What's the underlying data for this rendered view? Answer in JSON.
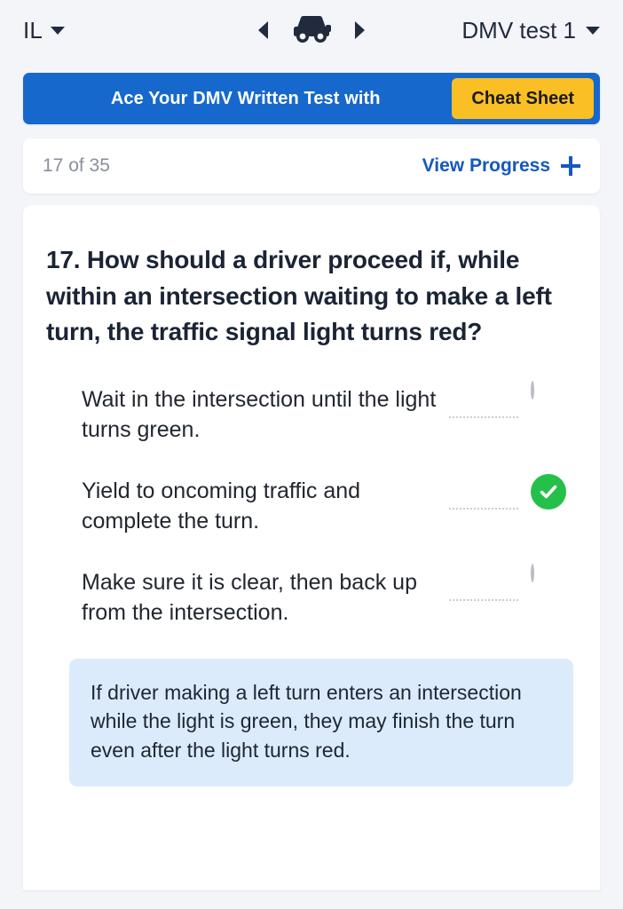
{
  "topbar": {
    "state": "IL",
    "state_caret_icon": "chevron-down-icon",
    "prev_icon": "triangle-left-icon",
    "vehicle_icon": "car-icon",
    "next_icon": "triangle-right-icon",
    "test_name": "DMV test 1",
    "test_caret_icon": "chevron-down-icon"
  },
  "promo": {
    "text": "Ace Your DMV Written Test with",
    "button_label": "Cheat Sheet",
    "bg_color": "#1668cc",
    "button_color": "#f9bf24"
  },
  "progress": {
    "count_label": "17 of 35",
    "current": 17,
    "total": 35,
    "view_progress_label": "View Progress",
    "plus_icon": "plus-icon",
    "accent_color": "#1558c0"
  },
  "question": {
    "number": "17.",
    "text": "17. How should a driver proceed if, while within an intersection waiting to make a left turn, the traffic signal light turns red?",
    "options": [
      {
        "label": "Wait in the intersection until the light turns green.",
        "state": "unselected",
        "marker_icon": "radio-empty-icon"
      },
      {
        "label": "Yield to oncoming traffic and complete the turn.",
        "state": "correct",
        "marker_icon": "check-circle-icon"
      },
      {
        "label": "Make sure it is clear, then back up from the intersection.",
        "state": "unselected",
        "marker_icon": "radio-empty-icon"
      }
    ],
    "correct_color": "#25c04a",
    "explanation": "If driver making a left turn enters an intersection while the light is green, they may finish the turn even after the light turns red."
  }
}
